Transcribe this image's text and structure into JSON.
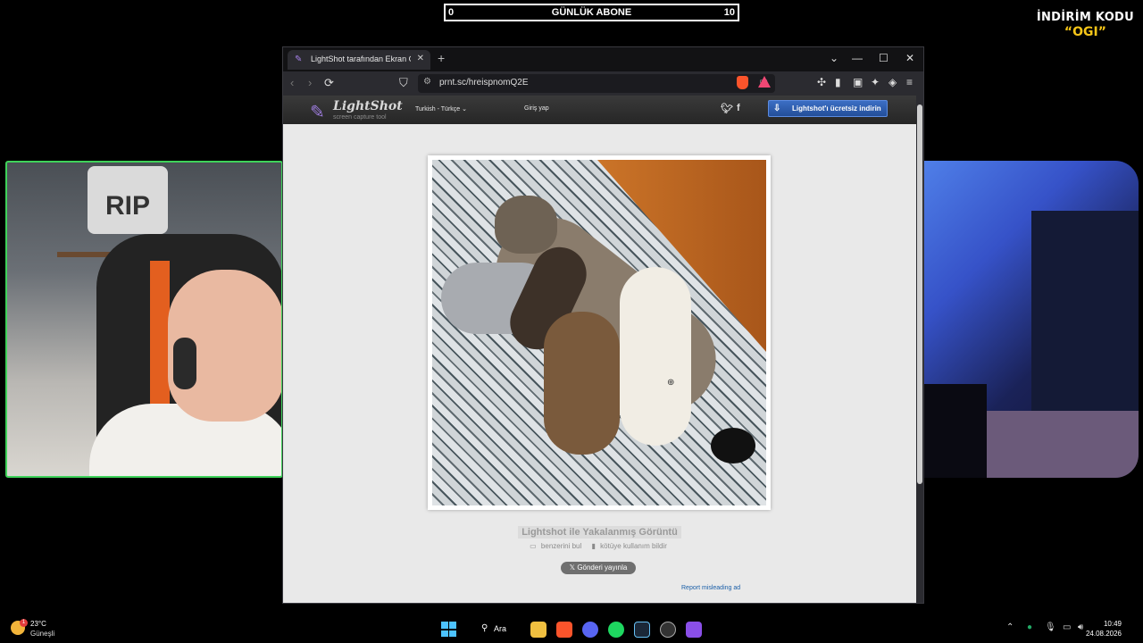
{
  "overlay": {
    "sub_counter": {
      "left": "0",
      "label": "GÜNLÜK ABONE",
      "right": "10"
    },
    "promo": {
      "line1": "İNDİRİM KODU",
      "line2": "“OGI”"
    }
  },
  "browser": {
    "tab": {
      "title": "LightShot tarafından Ekran Görüntüsü",
      "favicon": "feather-icon"
    },
    "url": "prnt.sc/hreispnomQ2E"
  },
  "lightshot": {
    "logo_name": "LightShot",
    "logo_tagline": "screen capture tool",
    "language": "Turkish - Türkçe",
    "login": "Giriş yap",
    "download_button": "Lightshot'ı ücretsiz indirin",
    "caption": "Lightshot ile Yakalanmış Görüntü",
    "similar_link": "benzerini bul",
    "report_link": "kötüye kullanım bildir",
    "tweet_button": "Gönderi yayınla",
    "report_ad": "Report misleading ad"
  },
  "taskbar": {
    "weather_temp": "23°C",
    "weather_cond": "Güneşli",
    "weather_badge": "1",
    "search_label": "Ara",
    "time": "10:49",
    "date": "24.08.2026"
  },
  "colors": {
    "accent_green": "#3fd25a",
    "promo_yellow": "#f5c518",
    "lightshot_button": "#234e99",
    "brave": "#fb542b"
  }
}
